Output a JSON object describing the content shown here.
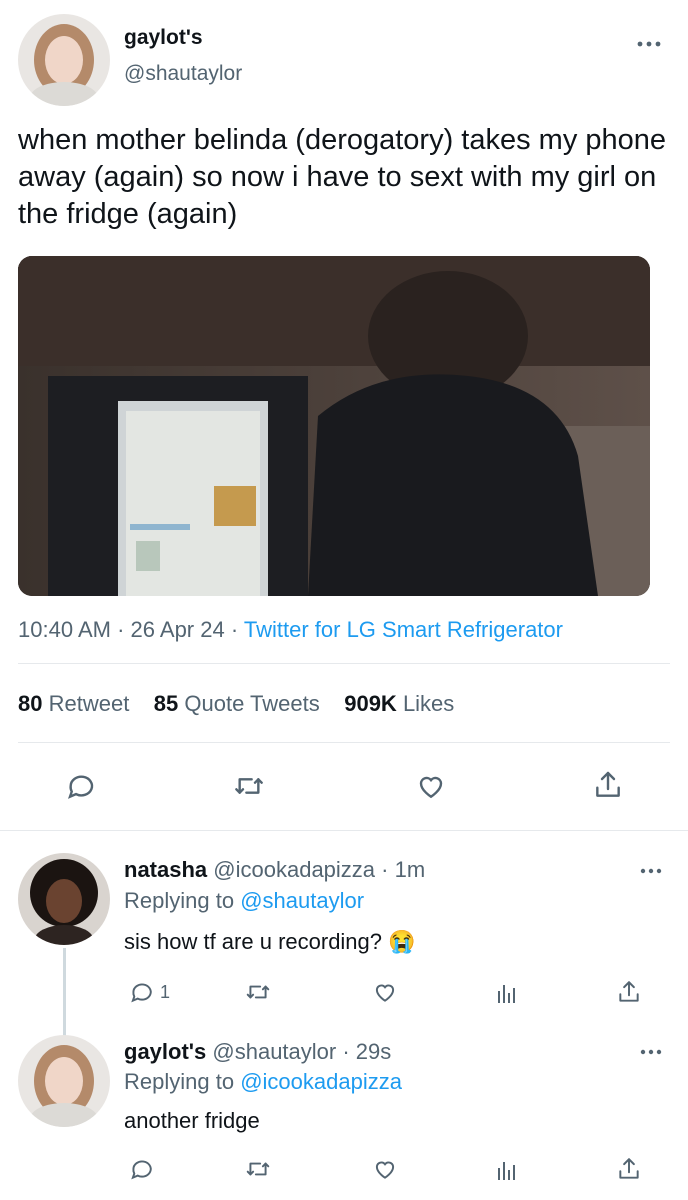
{
  "main_tweet": {
    "display_name": "gaylot's",
    "handle": "@shautaylor",
    "text": "when mother belinda (derogatory) takes my phone away (again) so now i have to sext with my girl on the fridge (again)",
    "time": "10:40 AM",
    "date": "26 Apr 24",
    "source": "Twitter for LG Smart Refrigerator",
    "separator": "·",
    "stats": {
      "retweets_count": "80",
      "retweets_label": "Retweet",
      "quotes_count": "85",
      "quotes_label": "Quote Tweets",
      "likes_count": "909K",
      "likes_label": "Likes"
    }
  },
  "replies": [
    {
      "display_name": "natasha",
      "handle": "@icookadapizza",
      "time": "· 1m",
      "replying_prefix": "Replying to",
      "replying_to": "@shautaylor",
      "text": "sis how tf are u recording? 😭",
      "reply_count": "1"
    },
    {
      "display_name": "gaylot's",
      "handle": "@shautaylor",
      "time": "· 29s",
      "replying_prefix": "Replying to",
      "replying_to": "@icookadapizza",
      "text": "another fridge",
      "reply_count": ""
    }
  ],
  "colors": {
    "accent": "#1d9bf0",
    "muted": "#536471",
    "divider": "#e6e9ec"
  },
  "icons": [
    "more-icon",
    "reply-icon",
    "retweet-icon",
    "like-icon",
    "share-icon",
    "analytics-icon",
    "emoji-crying"
  ]
}
